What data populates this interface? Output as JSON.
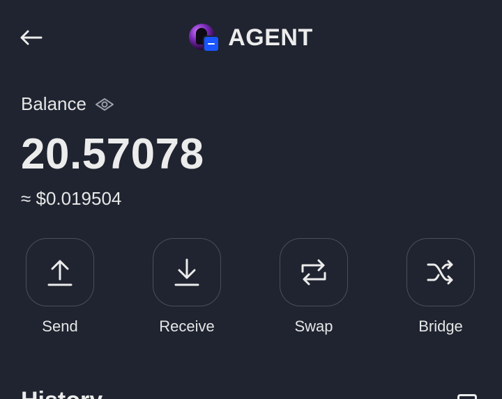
{
  "header": {
    "title": "AGENT",
    "back_icon": "arrow-left-icon",
    "token_icon": "token-logo",
    "chain_badge_color": "#1a56ff"
  },
  "balance": {
    "label": "Balance",
    "visibility_icon": "eye-icon",
    "amount": "20.57078",
    "fiat": "≈ $0.019504"
  },
  "actions": [
    {
      "label": "Send",
      "icon": "arrow-up-icon"
    },
    {
      "label": "Receive",
      "icon": "arrow-down-icon"
    },
    {
      "label": "Swap",
      "icon": "swap-icon"
    },
    {
      "label": "Bridge",
      "icon": "shuffle-icon"
    }
  ],
  "history": {
    "title": "History"
  },
  "colors": {
    "background": "#1f2430",
    "text": "#ececec",
    "button_border": "#4a4f5c"
  }
}
